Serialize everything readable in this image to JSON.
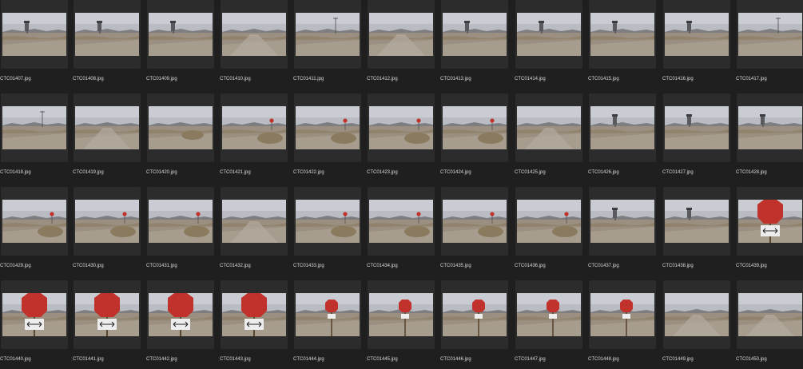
{
  "photos": [
    {
      "name": "CTC01407.jpg",
      "scene": "tower"
    },
    {
      "name": "CTC01408.jpg",
      "scene": "tower"
    },
    {
      "name": "CTC01409.jpg",
      "scene": "tower"
    },
    {
      "name": "CTC01410.jpg",
      "scene": "road"
    },
    {
      "name": "CTC01411.jpg",
      "scene": "pole"
    },
    {
      "name": "CTC01412.jpg",
      "scene": "road"
    },
    {
      "name": "CTC01413.jpg",
      "scene": "tower"
    },
    {
      "name": "CTC01414.jpg",
      "scene": "tower"
    },
    {
      "name": "CTC01415.jpg",
      "scene": "tower"
    },
    {
      "name": "CTC01416.jpg",
      "scene": "tower"
    },
    {
      "name": "CTC01417.jpg",
      "scene": "pole"
    },
    {
      "name": "CTC01418.jpg",
      "scene": "pole"
    },
    {
      "name": "CTC01419.jpg",
      "scene": "road"
    },
    {
      "name": "CTC01420.jpg",
      "scene": "bush"
    },
    {
      "name": "CTC01421.jpg",
      "scene": "stop-far"
    },
    {
      "name": "CTC01422.jpg",
      "scene": "stop-far"
    },
    {
      "name": "CTC01423.jpg",
      "scene": "stop-far"
    },
    {
      "name": "CTC01424.jpg",
      "scene": "stop-far"
    },
    {
      "name": "CTC01425.jpg",
      "scene": "road"
    },
    {
      "name": "CTC01426.jpg",
      "scene": "tower"
    },
    {
      "name": "CTC01427.jpg",
      "scene": "tower"
    },
    {
      "name": "CTC01428.jpg",
      "scene": "tower"
    },
    {
      "name": "CTC01429.jpg",
      "scene": "stop-far"
    },
    {
      "name": "CTC01430.jpg",
      "scene": "stop-far"
    },
    {
      "name": "CTC01431.jpg",
      "scene": "stop-far"
    },
    {
      "name": "CTC01432.jpg",
      "scene": "road"
    },
    {
      "name": "CTC01433.jpg",
      "scene": "stop-far"
    },
    {
      "name": "CTC01434.jpg",
      "scene": "stop-far"
    },
    {
      "name": "CTC01435.jpg",
      "scene": "stop-far"
    },
    {
      "name": "CTC01436.jpg",
      "scene": "stop-far"
    },
    {
      "name": "CTC01437.jpg",
      "scene": "tower"
    },
    {
      "name": "CTC01438.jpg",
      "scene": "tower"
    },
    {
      "name": "CTC01439.jpg",
      "scene": "stop-near"
    },
    {
      "name": "CTC01440.jpg",
      "scene": "stop-near"
    },
    {
      "name": "CTC01441.jpg",
      "scene": "stop-near"
    },
    {
      "name": "CTC01442.jpg",
      "scene": "stop-near"
    },
    {
      "name": "CTC01443.jpg",
      "scene": "stop-near"
    },
    {
      "name": "CTC01444.jpg",
      "scene": "stop-mid"
    },
    {
      "name": "CTC01445.jpg",
      "scene": "stop-mid"
    },
    {
      "name": "CTC01446.jpg",
      "scene": "stop-mid"
    },
    {
      "name": "CTC01447.jpg",
      "scene": "stop-mid"
    },
    {
      "name": "CTC01448.jpg",
      "scene": "stop-mid"
    },
    {
      "name": "CTC01449.jpg",
      "scene": "road"
    },
    {
      "name": "CTC01450.jpg",
      "scene": "road"
    }
  ],
  "colors": {
    "background": "#1f1f1f",
    "cell": "#2c2c2c",
    "label": "#d8d8d8",
    "sky": "#c9ccd2",
    "ground": "#9a8f80",
    "brush": "#8a7a5e",
    "stop_red": "#c0322b"
  }
}
